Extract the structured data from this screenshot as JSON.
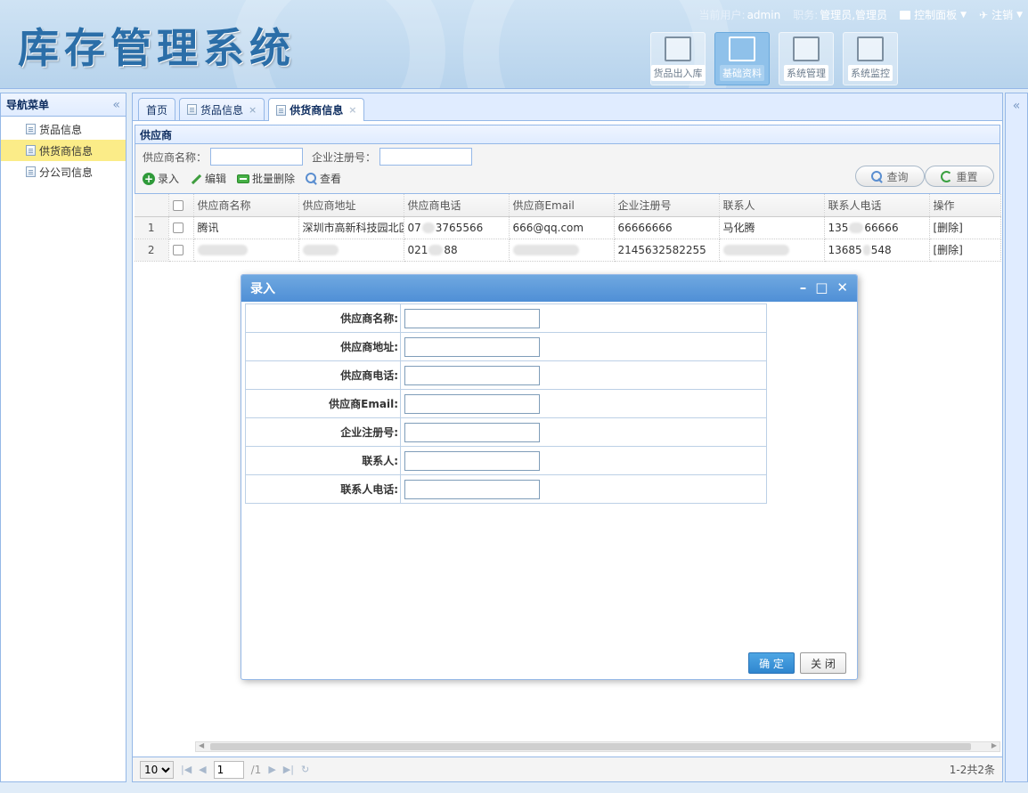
{
  "app": {
    "title": "库存管理系统"
  },
  "topbar": {
    "current_user_label": "当前用户:",
    "current_user": "admin",
    "role_label": "职务:",
    "role": "管理员,管理员",
    "control_panel": "控制面板",
    "logout": "注销"
  },
  "modules": [
    {
      "label": "货品出入库",
      "icon": "edit-icon",
      "active": false
    },
    {
      "label": "基础资料",
      "icon": "edit-icon",
      "active": true
    },
    {
      "label": "系统管理",
      "icon": "settings-icon",
      "active": false
    },
    {
      "label": "系统监控",
      "icon": "monitor-icon",
      "active": false
    }
  ],
  "nav": {
    "title": "导航菜单",
    "items": [
      {
        "label": "货品信息",
        "active": false
      },
      {
        "label": "供货商信息",
        "active": true
      },
      {
        "label": "分公司信息",
        "active": false
      }
    ]
  },
  "tabs": [
    {
      "label": "首页",
      "closable": false,
      "active": false
    },
    {
      "label": "货品信息",
      "closable": true,
      "active": false
    },
    {
      "label": "供货商信息",
      "closable": true,
      "active": true
    }
  ],
  "grid": {
    "title": "供应商",
    "search": {
      "name_label": "供应商名称：",
      "name_value": "",
      "reg_label": "企业注册号：",
      "reg_value": ""
    },
    "actions": {
      "add": "录入",
      "edit": "编辑",
      "batch_delete": "批量删除",
      "view": "查看"
    },
    "query_button": "查询",
    "reset_button": "重置",
    "columns": [
      "供应商名称",
      "供应商地址",
      "供应商电话",
      "供应商Email",
      "企业注册号",
      "联系人",
      "联系人电话",
      "操作"
    ],
    "rows": [
      {
        "num": "1",
        "name": "腾讯",
        "address": "深圳市高新科技园北区",
        "phone": "07",
        "phone_tail": "3765566",
        "email": "666@qq.com",
        "reg": "66666666",
        "contact": "马化腾",
        "contact_phone": "135",
        "contact_phone_tail": "66666",
        "op": "[删除]"
      },
      {
        "num": "2",
        "name": "",
        "address": "",
        "phone": "021",
        "phone_tail": "88",
        "email": "",
        "reg": "2145632582255",
        "contact": "",
        "contact_phone": "13685",
        "contact_phone_tail": "548",
        "op": "[删除]"
      }
    ]
  },
  "pager": {
    "page_size": "10",
    "page": "1",
    "total_pages": "/1",
    "info": "1-2共2条"
  },
  "dialog": {
    "title": "录入",
    "fields": [
      {
        "label": "供应商名称:",
        "value": ""
      },
      {
        "label": "供应商地址:",
        "value": ""
      },
      {
        "label": "供应商电话:",
        "value": ""
      },
      {
        "label": "供应商Email:",
        "value": ""
      },
      {
        "label": "企业注册号:",
        "value": ""
      },
      {
        "label": "联系人:",
        "value": ""
      },
      {
        "label": "联系人电话:",
        "value": ""
      }
    ],
    "ok": "确 定",
    "close": "关 闭"
  }
}
